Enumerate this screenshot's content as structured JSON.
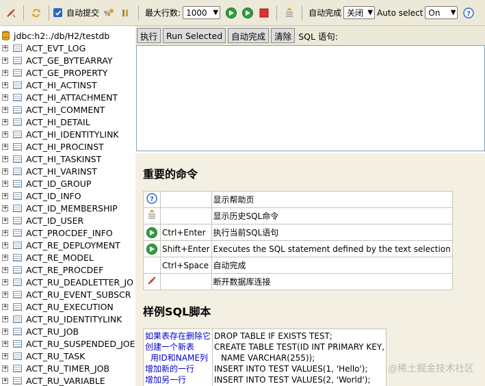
{
  "toolbar": {
    "autocommit_label": "自动提交",
    "max_rows_label": "最大行数:",
    "max_rows_value": "1000",
    "autocomplete_label": "自动完成",
    "autocomplete_value": "关闭",
    "auto_select_label": "Auto select",
    "auto_select_value": "On"
  },
  "tree": {
    "root_label": "jdbc:h2:./db/H2/testdb",
    "items": [
      "ACT_EVT_LOG",
      "ACT_GE_BYTEARRAY",
      "ACT_GE_PROPERTY",
      "ACT_HI_ACTINST",
      "ACT_HI_ATTACHMENT",
      "ACT_HI_COMMENT",
      "ACT_HI_DETAIL",
      "ACT_HI_IDENTITYLINK",
      "ACT_HI_PROCINST",
      "ACT_HI_TASKINST",
      "ACT_HI_VARINST",
      "ACT_ID_GROUP",
      "ACT_ID_INFO",
      "ACT_ID_MEMBERSHIP",
      "ACT_ID_USER",
      "ACT_PROCDEF_INFO",
      "ACT_RE_DEPLOYMENT",
      "ACT_RE_MODEL",
      "ACT_RE_PROCDEF",
      "ACT_RU_DEADLETTER_JO",
      "ACT_RU_EVENT_SUBSCR",
      "ACT_RU_EXECUTION",
      "ACT_RU_IDENTITYLINK",
      "ACT_RU_JOB",
      "ACT_RU_SUSPENDED_JOE",
      "ACT_RU_TASK",
      "ACT_RU_TIMER_JOB",
      "ACT_RU_VARIABLE"
    ]
  },
  "sql_toolbar": {
    "execute": "执行",
    "run_selected": "Run Selected",
    "autocomplete": "自动完成",
    "clear": "清除",
    "label": "SQL 语句:"
  },
  "help": {
    "commands_title": "重要的命令",
    "commands": [
      {
        "icon": "help-icon",
        "key": "",
        "desc": "显示帮助页"
      },
      {
        "icon": "history-icon",
        "key": "",
        "desc": "显示历史SQL命令"
      },
      {
        "icon": "run-icon",
        "key": "Ctrl+Enter",
        "desc": "执行当前SQL语句"
      },
      {
        "icon": "run-selected-icon",
        "key": "Shift+Enter",
        "desc": "Executes the SQL statement defined by the text selection"
      },
      {
        "icon": "",
        "key": "Ctrl+Space",
        "desc": "自动完成"
      },
      {
        "icon": "disconnect-icon",
        "key": "",
        "desc": "断开数据库连接"
      }
    ],
    "examples_title": "样例SQL脚本",
    "examples_left": [
      "如果表存在删除它",
      "创建一个新表",
      "用ID和NAME列",
      "增加新的一行",
      "增加另一行"
    ],
    "examples_right": [
      "DROP TABLE IF EXISTS TEST;",
      "CREATE TABLE TEST(ID INT PRIMARY KEY,",
      "NAME VARCHAR(255));",
      "INSERT INTO TEST VALUES(1, 'Hello');",
      "INSERT INTO TEST VALUES(2, 'World');"
    ]
  },
  "watermark": "@稀土掘金技术社区"
}
